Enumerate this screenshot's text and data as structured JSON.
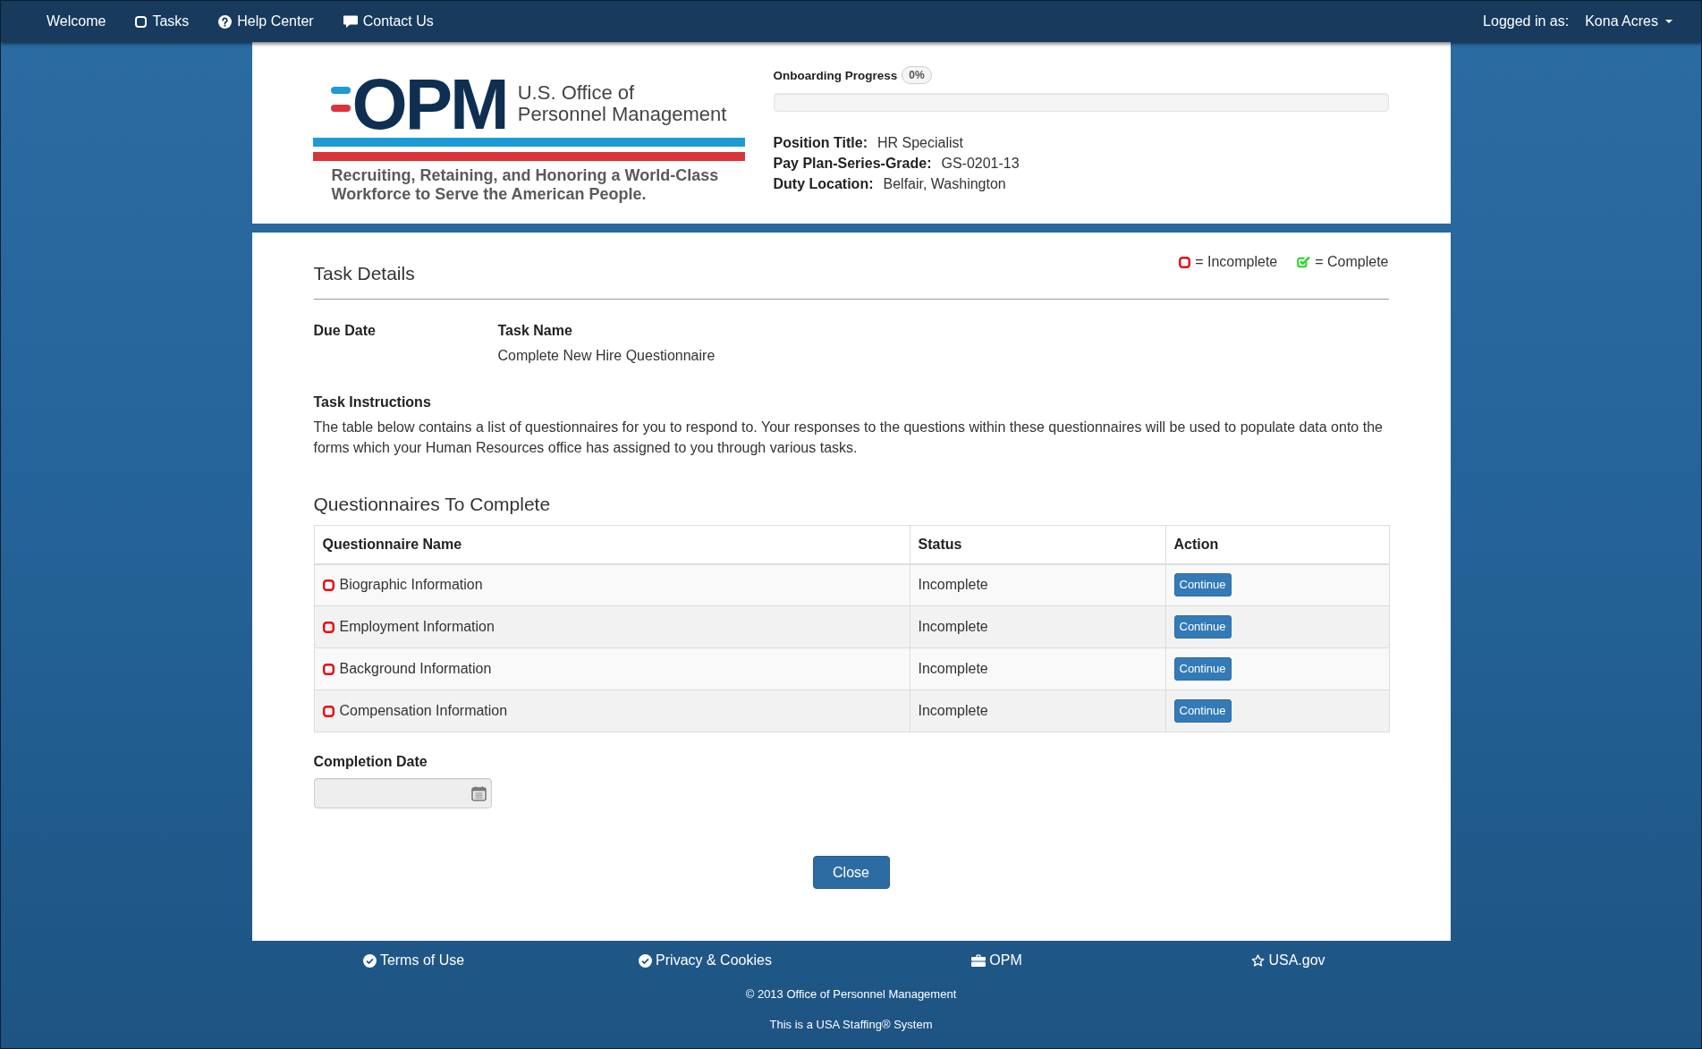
{
  "nav": {
    "items": [
      {
        "label": "Welcome",
        "kind": "plain"
      },
      {
        "label": "Tasks",
        "kind": "square"
      },
      {
        "label": "Help Center",
        "kind": "help"
      },
      {
        "label": "Contact Us",
        "kind": "comment"
      }
    ],
    "user_label": "Logged in as:",
    "user_name": "Kona Acres"
  },
  "header": {
    "logo": {
      "wordmark": "OPM",
      "name_lines": [
        "U.S. Office of",
        "Personnel Management"
      ],
      "tagline_lines": [
        "Recruiting, Retaining, and Honoring a World-Class",
        "Workforce to Serve the American People."
      ]
    },
    "progress": {
      "label": "Onboarding Progress",
      "badge": "0%",
      "level": 0
    },
    "details": [
      {
        "label": "Position Title:",
        "value": "HR Specialist"
      },
      {
        "label": "Pay Plan-Series-Grade:",
        "value": "GS-0201-13"
      },
      {
        "label": "Duty Location:",
        "value": "Belfair, Washington"
      }
    ]
  },
  "task_details": {
    "title": "Task Details",
    "legend": [
      {
        "kind": "incomplete",
        "label": "= Incomplete"
      },
      {
        "kind": "complete",
        "label": "= Complete"
      }
    ],
    "fields": [
      {
        "label": "Due Date"
      },
      {
        "label": "Task Name",
        "value": "Complete New Hire Questionnaire"
      }
    ],
    "instructions": {
      "label": "Task Instructions",
      "text": "The table below contains a list of questionnaires for you to respond to. Your responses to the questions within these questionnaires will be used to populate data onto the forms which your Human Resources office has assigned to you through various tasks."
    }
  },
  "questionnaires": {
    "title": "Questionnaires To Complete",
    "columns": [
      "Questionnaire Name",
      "Status",
      "Action"
    ],
    "rows": [
      {
        "name": "Biographic Information",
        "complete": false,
        "status": "Incomplete",
        "action": "Continue"
      },
      {
        "name": "Employment Information",
        "complete": false,
        "status": "Incomplete",
        "action": "Continue"
      },
      {
        "name": "Background Information",
        "complete": false,
        "status": "Incomplete",
        "action": "Continue"
      },
      {
        "name": "Compensation Information",
        "complete": false,
        "status": "Incomplete",
        "action": "Continue"
      }
    ]
  },
  "completion_date": {
    "label": "Completion Date"
  },
  "close_button": "Close",
  "footer": {
    "links": [
      {
        "label": "Terms of Use",
        "kind": "check"
      },
      {
        "label": "Privacy & Cookies",
        "kind": "check"
      },
      {
        "label": "OPM",
        "kind": "briefcase"
      },
      {
        "label": "USA.gov",
        "kind": "star"
      }
    ],
    "copyright": "© 2013 Office of Personnel Management",
    "system_note": "This is a USA Staffing® System"
  }
}
